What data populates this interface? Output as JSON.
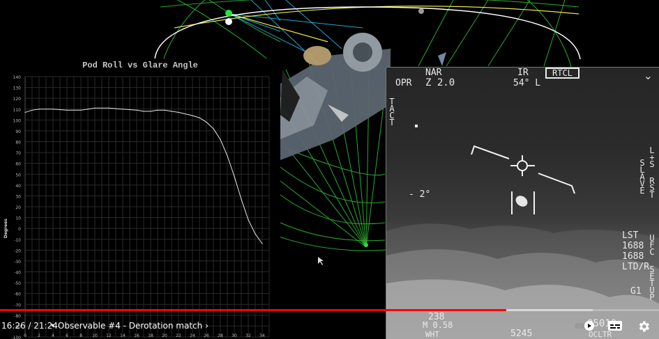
{
  "chart": {
    "title": "Pod Roll vs Glare Angle",
    "ylabel": "Degrees",
    "y_ticks": [
      "140",
      "130",
      "120",
      "110",
      "100",
      "90",
      "80",
      "70",
      "60",
      "50",
      "40",
      "30",
      "20",
      "10",
      "0",
      "-10",
      "-20",
      "-30",
      "-40",
      "-50",
      "-60",
      "-70",
      "-80",
      "-90",
      "-100"
    ],
    "x_ticks": [
      "0",
      "2",
      "4",
      "6",
      "8",
      "10",
      "12",
      "14",
      "16",
      "18",
      "20",
      "22",
      "24",
      "26",
      "28",
      "30",
      "32",
      "34"
    ]
  },
  "chart_data": {
    "type": "line",
    "title": "Pod Roll vs Glare Angle",
    "xlabel": "",
    "ylabel": "Degrees",
    "xlim": [
      0,
      35
    ],
    "ylim": [
      -100,
      140
    ],
    "grid": true,
    "series": [
      {
        "x": [
          0,
          1,
          2,
          4,
          6,
          8,
          9,
          10,
          12,
          14,
          16,
          17,
          18,
          19,
          20,
          21,
          22,
          24,
          25,
          26,
          27,
          28,
          29,
          30,
          31,
          32,
          33,
          34
        ],
        "values": [
          107,
          109,
          110,
          110,
          109,
          109,
          110,
          111,
          111,
          110,
          109,
          108,
          108,
          109,
          109,
          108,
          107,
          104,
          102,
          98,
          92,
          82,
          67,
          48,
          27,
          8,
          -5,
          -14
        ]
      }
    ]
  },
  "hud": {
    "opr": "OPR",
    "nar": "NAR",
    "zoom": "Z 2.0",
    "ir": "IR",
    "az": "54° L",
    "rtcl": "RTCL",
    "tact": "TACT",
    "elev": "- 2°",
    "slave": "SLAVE",
    "los": "L+S",
    "rst": "RST",
    "lst": "LST",
    "code1": "1688",
    "code2": "1688",
    "ltd": "LTD/R",
    "ufc": "UFC",
    "setup": "SET UP",
    "g1": "G1",
    "bottom_left": "238",
    "mach": "M 0.58",
    "wht": "WHT",
    "alt": "5245",
    "time": "05010",
    "ocltr": "OCLTR"
  },
  "player": {
    "current_time": "16:26",
    "duration": "21:24",
    "time_display": "16:26 / 21:24",
    "chapter": "Observable #4 - Derotation match",
    "chapter_arrow": "›",
    "progress": 0.768,
    "buffered": 0.9
  },
  "colors": {
    "progress": "#ff0000",
    "grid_green": "#39d43a",
    "ring_yellow": "#e6e64a",
    "sky_cyan": "#2fd0ff"
  }
}
